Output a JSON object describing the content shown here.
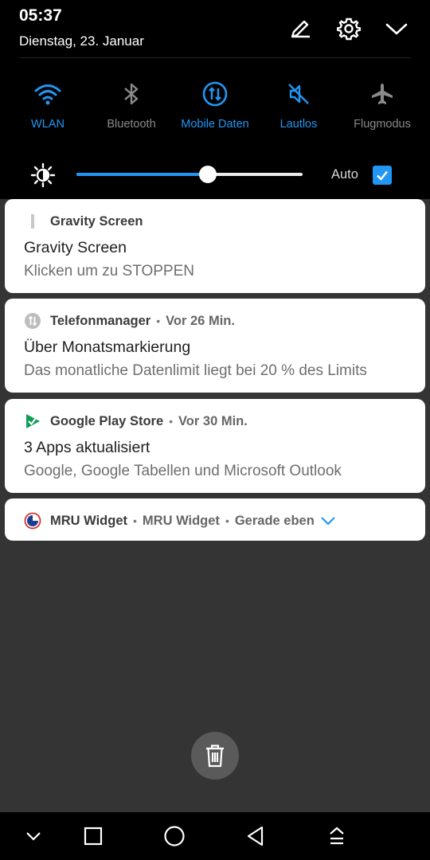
{
  "status": {
    "time": "05:37",
    "date": "Dienstag, 23. Januar"
  },
  "header_icons": [
    "edit-icon",
    "gear-icon",
    "chevron-down-icon"
  ],
  "quick_settings": [
    {
      "label": "WLAN",
      "icon": "wifi-icon",
      "active": true
    },
    {
      "label": "Bluetooth",
      "icon": "bluetooth-icon",
      "active": false
    },
    {
      "label": "Mobile Daten",
      "icon": "mobile-data-icon",
      "active": true
    },
    {
      "label": "Lautlos",
      "icon": "mute-icon",
      "active": true
    },
    {
      "label": "Flugmodus",
      "icon": "airplane-icon",
      "active": false
    }
  ],
  "brightness": {
    "level": 0.58,
    "auto_label": "Auto",
    "auto_checked": true
  },
  "notifications": [
    {
      "app": "Gravity Screen",
      "time": "",
      "title": "Gravity Screen",
      "text": "Klicken um zu STOPPEN",
      "icon": "gravity-screen-icon"
    },
    {
      "app": "Telefonmanager",
      "time": "Vor 26 Min.",
      "title": "Über Monatsmarkierung",
      "text": "Das monatliche Datenlimit liegt bei 20 % des Limits",
      "icon": "phone-manager-icon"
    },
    {
      "app": "Google Play Store",
      "time": "Vor 30 Min.",
      "title": "3 Apps aktualisiert",
      "text": "Google, Google Tabellen und Microsoft Outlook",
      "icon": "play-store-icon"
    },
    {
      "app": "MRU Widget",
      "subtext": "MRU Widget",
      "time": "Gerade eben",
      "icon": "mru-widget-icon"
    }
  ],
  "colors": {
    "accent": "#2196f3",
    "shade_bg": "#000000",
    "panel_bg": "#343434",
    "card_bg": "#ffffff"
  },
  "navbar_icons": [
    "chevron-down-icon",
    "recent-apps-icon",
    "home-icon",
    "back-icon",
    "notification-pull-icon"
  ]
}
